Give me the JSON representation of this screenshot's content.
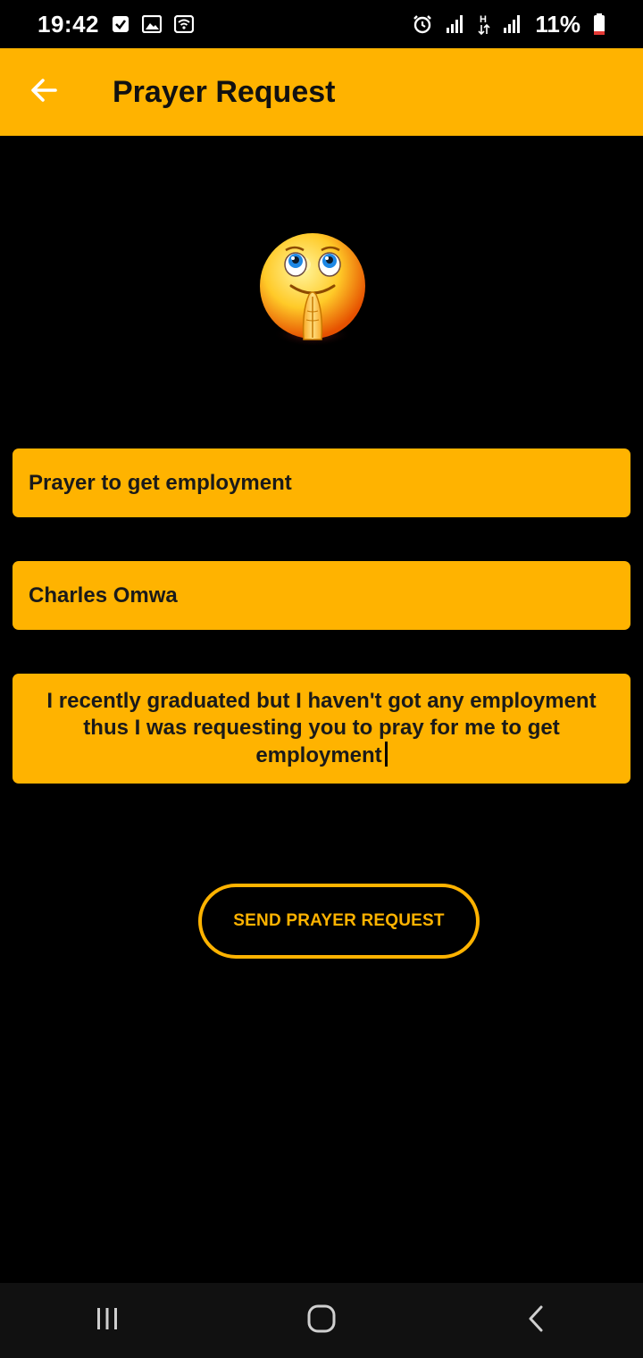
{
  "status_bar": {
    "time": "19:42",
    "battery": "11%",
    "icons": [
      "check-box-icon",
      "image-icon",
      "wifi-calling-icon",
      "alarm-icon",
      "signal-icon",
      "data-h-icon",
      "signal-icon",
      "battery-low-icon"
    ]
  },
  "app_bar": {
    "title": "Prayer Request",
    "back_icon": "arrow-left-icon"
  },
  "emoji": "praying-face-emoji",
  "form": {
    "subject_value": "Prayer to get employment",
    "name_value": "Charles Omwa",
    "message_value": "I  recently graduated but I haven't got any employment thus I was requesting you to pray for me to get employment"
  },
  "send_button_label": "SEND PRAYER REQUEST",
  "nav_bar": {
    "icons": [
      "recent-apps-icon",
      "home-icon",
      "back-icon"
    ]
  },
  "colors": {
    "accent": "#FFB300",
    "background": "#000000",
    "nav": "#111111"
  }
}
